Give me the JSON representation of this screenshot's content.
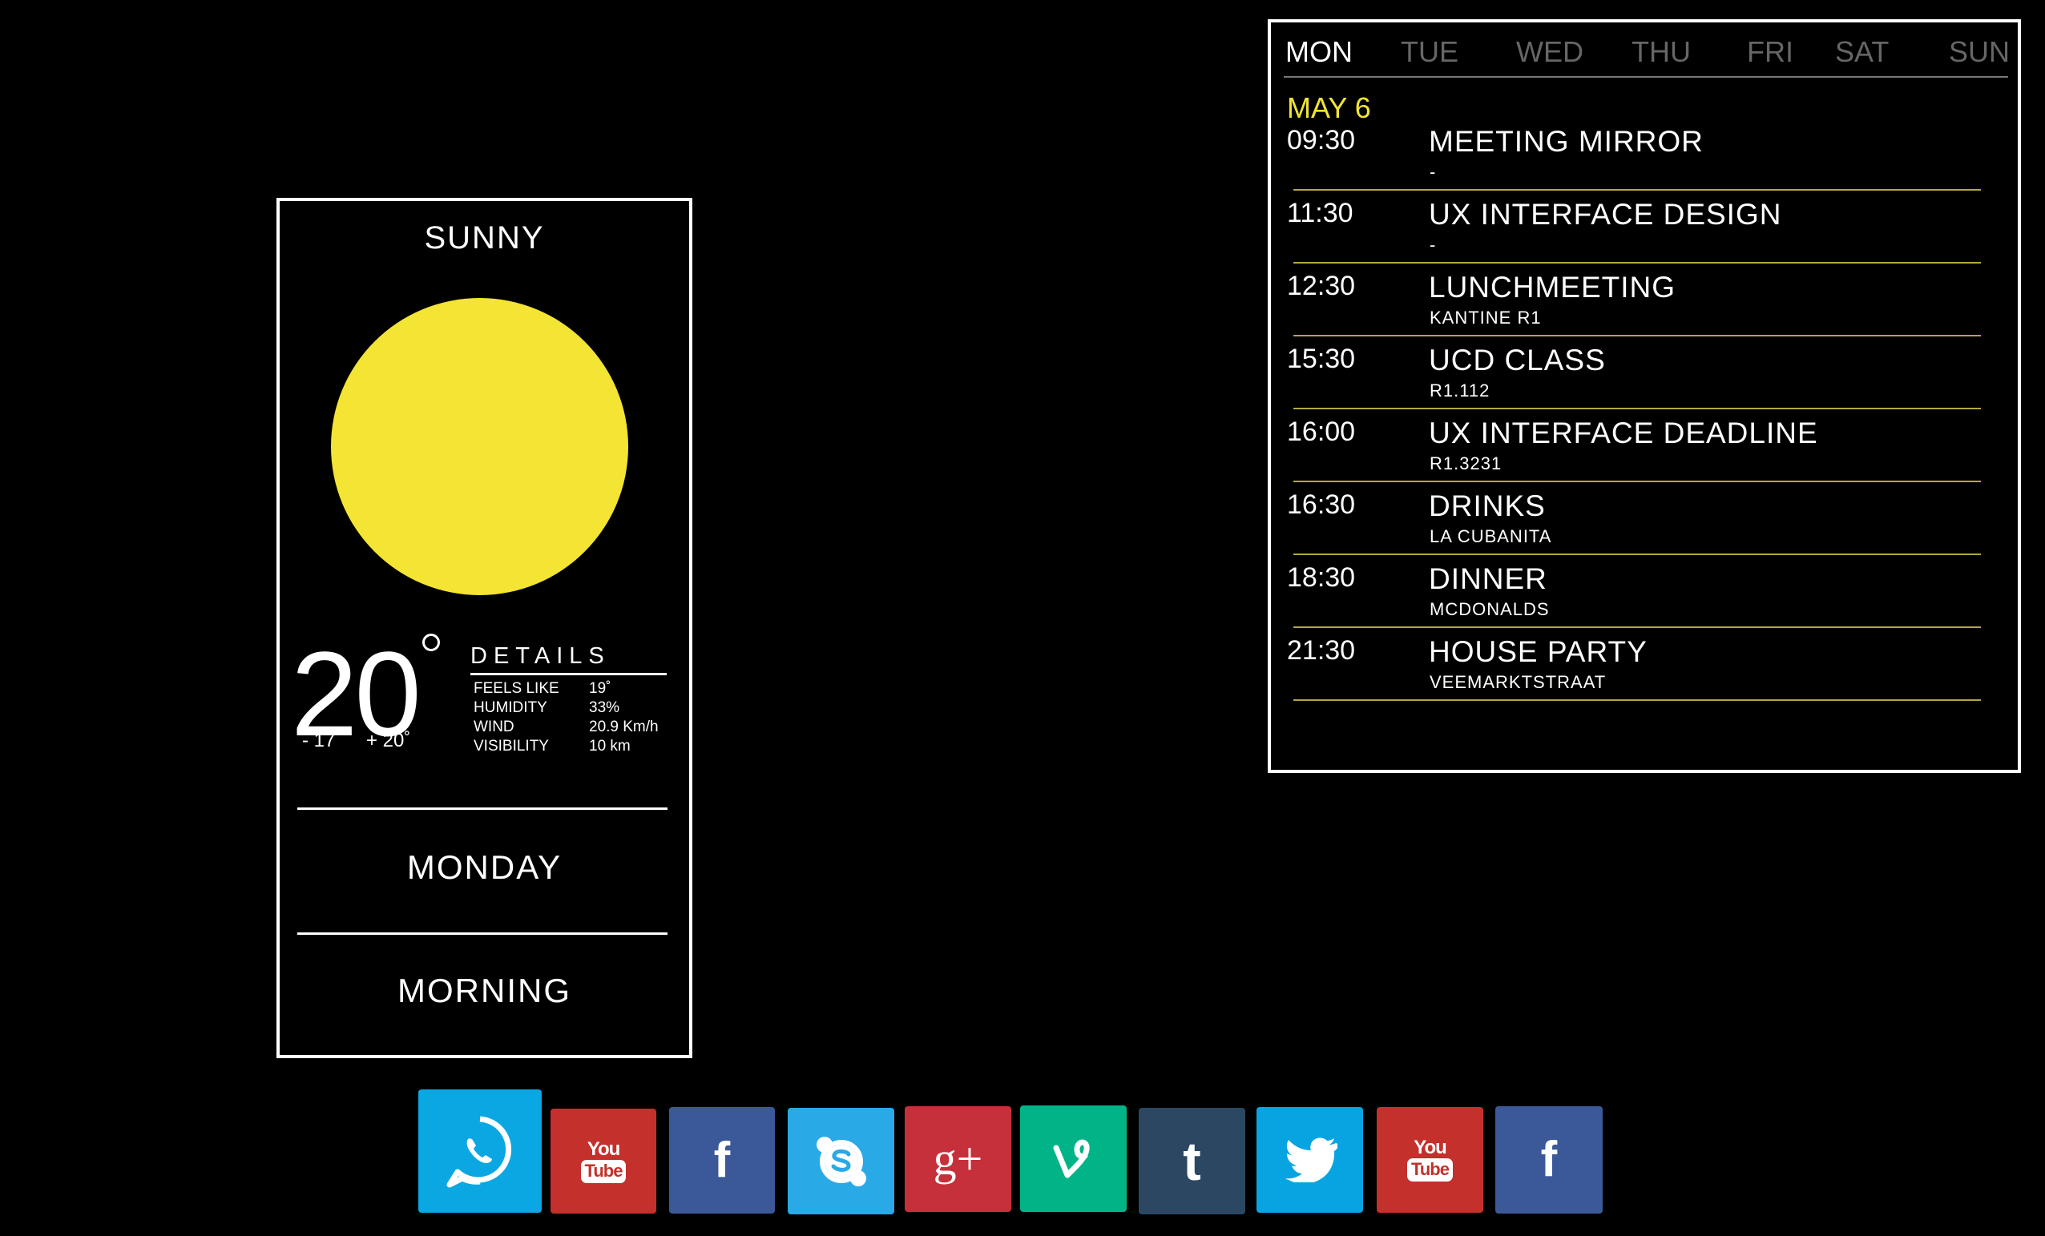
{
  "weather": {
    "condition": "SUNNY",
    "sun_color": "#f4e433",
    "temperature": "20",
    "temp_min": "- 17˚",
    "temp_max": "+ 20˚",
    "details_title": "DETAILS",
    "details": [
      {
        "label": "FEELS LIKE",
        "value": "19˚"
      },
      {
        "label": "HUMIDITY",
        "value": "33%"
      },
      {
        "label": "WIND",
        "value": "20.9 Km/h"
      },
      {
        "label": "VISIBILITY",
        "value": "10 km"
      }
    ],
    "day": "MONDAY",
    "part_of_day": "MORNING"
  },
  "calendar": {
    "days": [
      "MON",
      "TUE",
      "WED",
      "THU",
      "FRI",
      "SAT",
      "SUN"
    ],
    "active_day": "MON",
    "date": "MAY 6",
    "date_color": "#f2e533",
    "events": [
      {
        "time": "09:30",
        "title": "MEETING MIRROR",
        "location": "-"
      },
      {
        "time": "11:30",
        "title": "UX INTERFACE DESIGN",
        "location": "-"
      },
      {
        "time": "12:30",
        "title": "LUNCHMEETING",
        "location": "KANTINE R1"
      },
      {
        "time": "15:30",
        "title": "UCD CLASS",
        "location": "R1.112"
      },
      {
        "time": "16:00",
        "title": "UX INTERFACE DEADLINE",
        "location": "R1.3231"
      },
      {
        "time": "16:30",
        "title": "DRINKS",
        "location": "LA CUBANITA"
      },
      {
        "time": "18:30",
        "title": "DINNER",
        "location": "MCDONALDS"
      },
      {
        "time": "21:30",
        "title": "HOUSE PARTY",
        "location": "VEEMARKTSTRAAT"
      }
    ]
  },
  "social": {
    "buttons": [
      {
        "name": "whatsapp",
        "icon": "whatsapp-icon",
        "color": "#0aa7e3"
      },
      {
        "name": "youtube",
        "icon": "youtube-icon",
        "color": "#c4302b",
        "text_top": "You",
        "text_bottom": "Tube"
      },
      {
        "name": "facebook",
        "icon": "facebook-icon",
        "color": "#3b5998",
        "glyph": "f"
      },
      {
        "name": "skype",
        "icon": "skype-icon",
        "color": "#29a9e6"
      },
      {
        "name": "google-plus",
        "icon": "google-plus-icon",
        "color": "#c6303a",
        "glyph": "g+"
      },
      {
        "name": "vine",
        "icon": "vine-icon",
        "color": "#00b488"
      },
      {
        "name": "tumblr",
        "icon": "tumblr-icon",
        "color": "#2c4762",
        "glyph": "t"
      },
      {
        "name": "twitter",
        "icon": "twitter-icon",
        "color": "#08a4e1"
      },
      {
        "name": "youtube-2",
        "icon": "youtube-icon",
        "color": "#c4302b",
        "text_top": "You",
        "text_bottom": "Tube"
      },
      {
        "name": "facebook-2",
        "icon": "facebook-icon",
        "color": "#3b5998",
        "glyph": "f"
      }
    ]
  }
}
